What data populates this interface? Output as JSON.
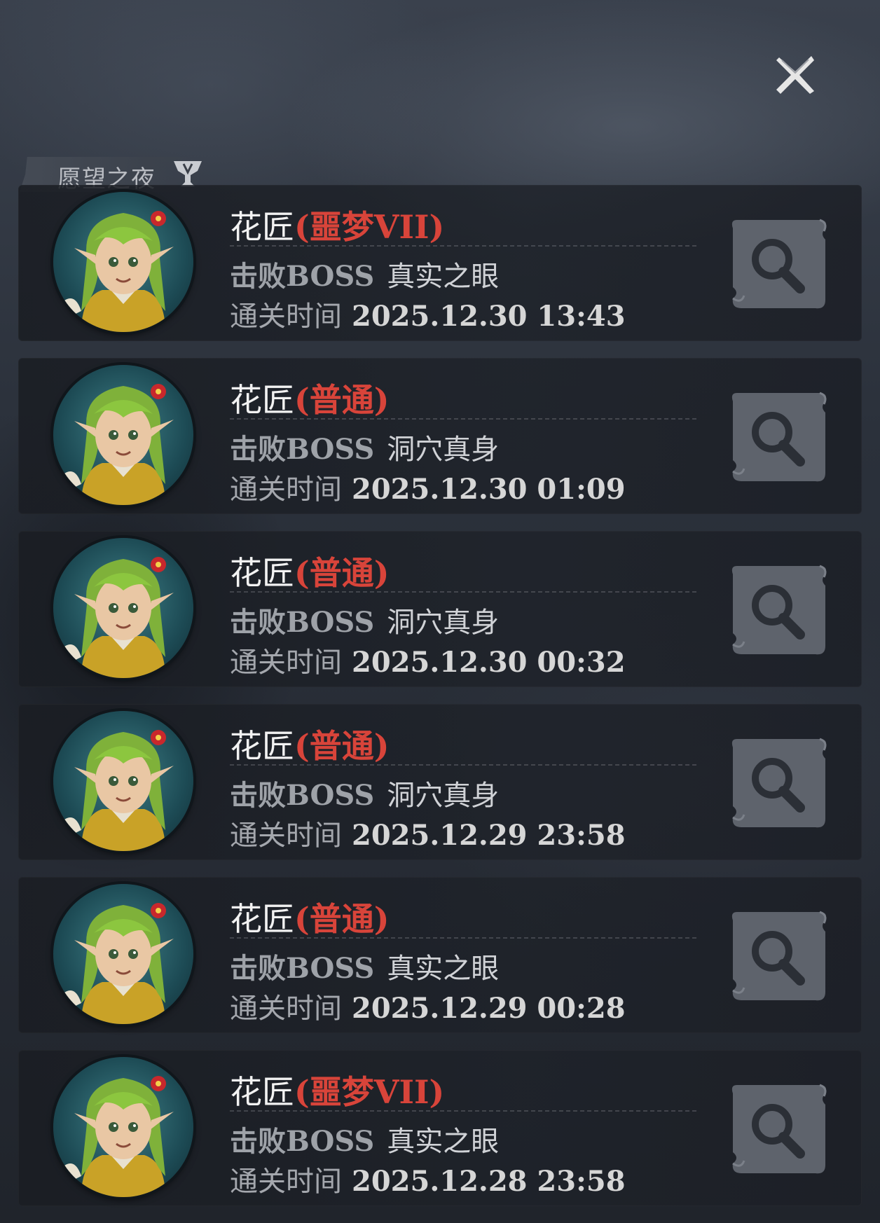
{
  "header": {
    "close_icon": "close-icon"
  },
  "tag": {
    "label": "愿望之夜",
    "icon": "trophy-icon"
  },
  "records": [
    {
      "hero": "花匠",
      "difficulty": "(噩梦VII)",
      "boss_label": "击败BOSS",
      "boss": "真实之眼",
      "time_label": "通关时间",
      "time": "2025.12.30 13:43"
    },
    {
      "hero": "花匠",
      "difficulty": "(普通)",
      "boss_label": "击败BOSS",
      "boss": "洞穴真身",
      "time_label": "通关时间",
      "time": "2025.12.30 01:09"
    },
    {
      "hero": "花匠",
      "difficulty": "(普通)",
      "boss_label": "击败BOSS",
      "boss": "洞穴真身",
      "time_label": "通关时间",
      "time": "2025.12.30 00:32"
    },
    {
      "hero": "花匠",
      "difficulty": "(普通)",
      "boss_label": "击败BOSS",
      "boss": "洞穴真身",
      "time_label": "通关时间",
      "time": "2025.12.29 23:58"
    },
    {
      "hero": "花匠",
      "difficulty": "(普通)",
      "boss_label": "击败BOSS",
      "boss": "真实之眼",
      "time_label": "通关时间",
      "time": "2025.12.29 00:28"
    },
    {
      "hero": "花匠",
      "difficulty": "(噩梦VII)",
      "boss_label": "击败BOSS",
      "boss": "真实之眼",
      "time_label": "通关时间",
      "time": "2025.12.28 23:58"
    }
  ],
  "colors": {
    "difficulty": "#d8443a",
    "hero": "#f2f2f2"
  }
}
